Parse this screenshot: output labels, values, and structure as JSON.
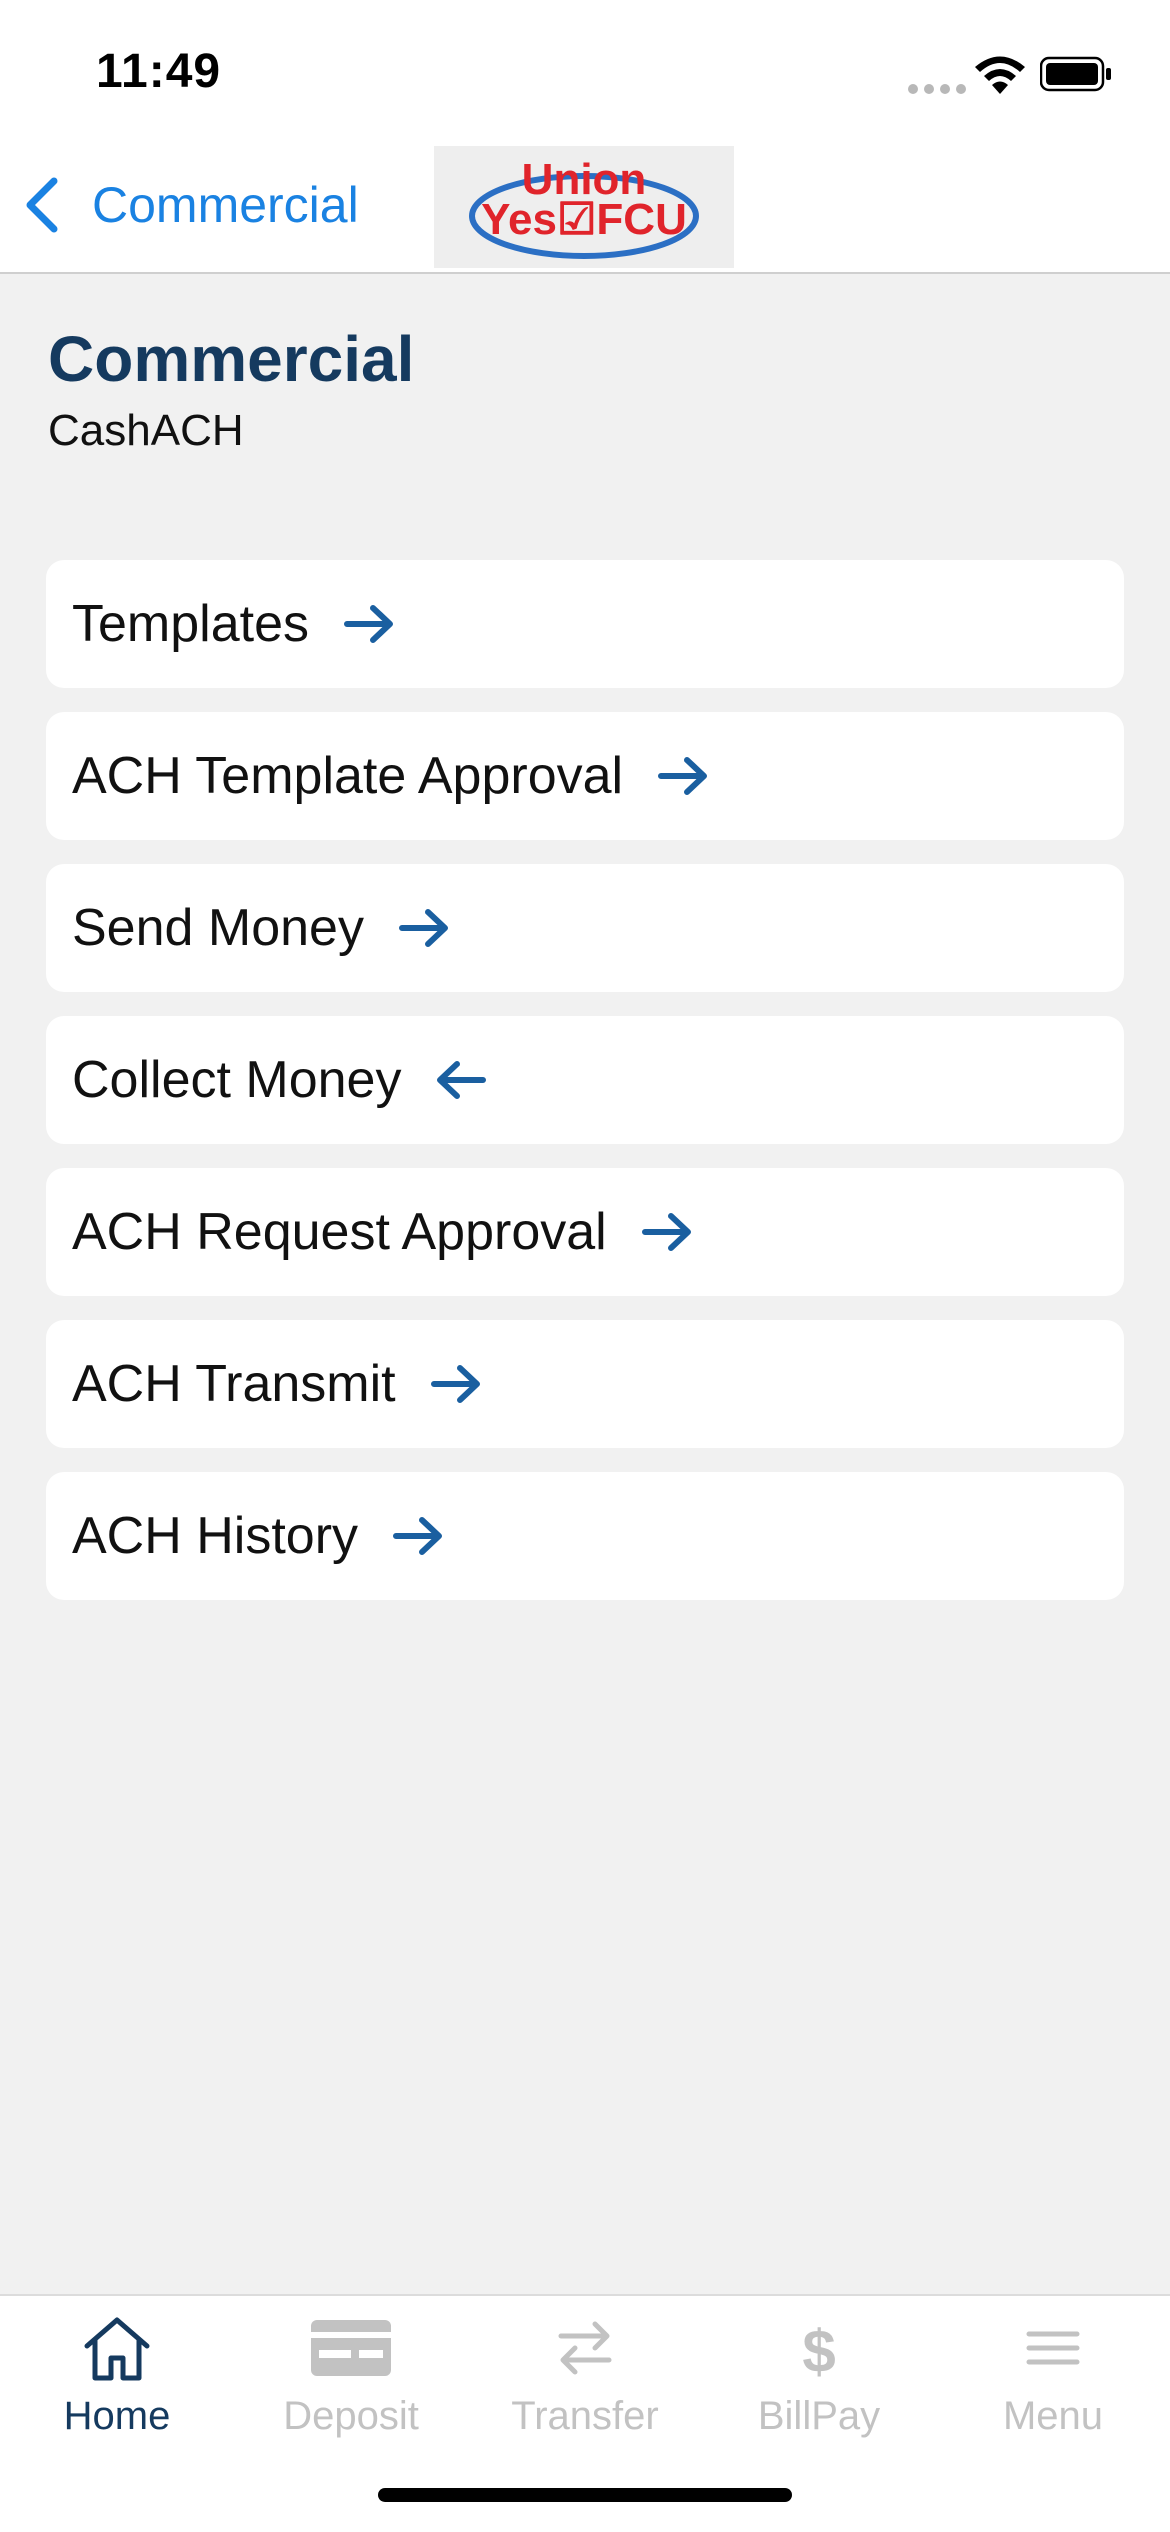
{
  "status_bar": {
    "time": "11:49"
  },
  "nav": {
    "back_label": "Commercial",
    "logo_text_top": "Union",
    "logo_text_bottom": "Yes FCU"
  },
  "header": {
    "title": "Commercial",
    "subtitle": "CashACH"
  },
  "menu": {
    "items": [
      {
        "label": "Templates",
        "icon": "arrow-right-icon"
      },
      {
        "label": "ACH Template Approval",
        "icon": "arrow-right-icon"
      },
      {
        "label": "Send Money",
        "icon": "arrow-right-icon"
      },
      {
        "label": "Collect Money",
        "icon": "arrow-left-icon"
      },
      {
        "label": "ACH Request Approval",
        "icon": "arrow-right-icon"
      },
      {
        "label": "ACH Transmit",
        "icon": "arrow-right-icon"
      },
      {
        "label": "ACH History",
        "icon": "arrow-right-icon"
      }
    ]
  },
  "tab_bar": {
    "tabs": [
      {
        "label": "Home",
        "icon": "home-icon",
        "active": true
      },
      {
        "label": "Deposit",
        "icon": "check-deposit-icon",
        "active": false
      },
      {
        "label": "Transfer",
        "icon": "transfer-icon",
        "active": false
      },
      {
        "label": "BillPay",
        "icon": "dollar-icon",
        "active": false
      },
      {
        "label": "Menu",
        "icon": "menu-icon",
        "active": false
      }
    ]
  },
  "colors": {
    "accent": "#1a82e2",
    "title": "#153a5f",
    "arrow": "#1a5fa0",
    "inactive_tab": "#c2c2c2",
    "background": "#f1f1f1"
  }
}
